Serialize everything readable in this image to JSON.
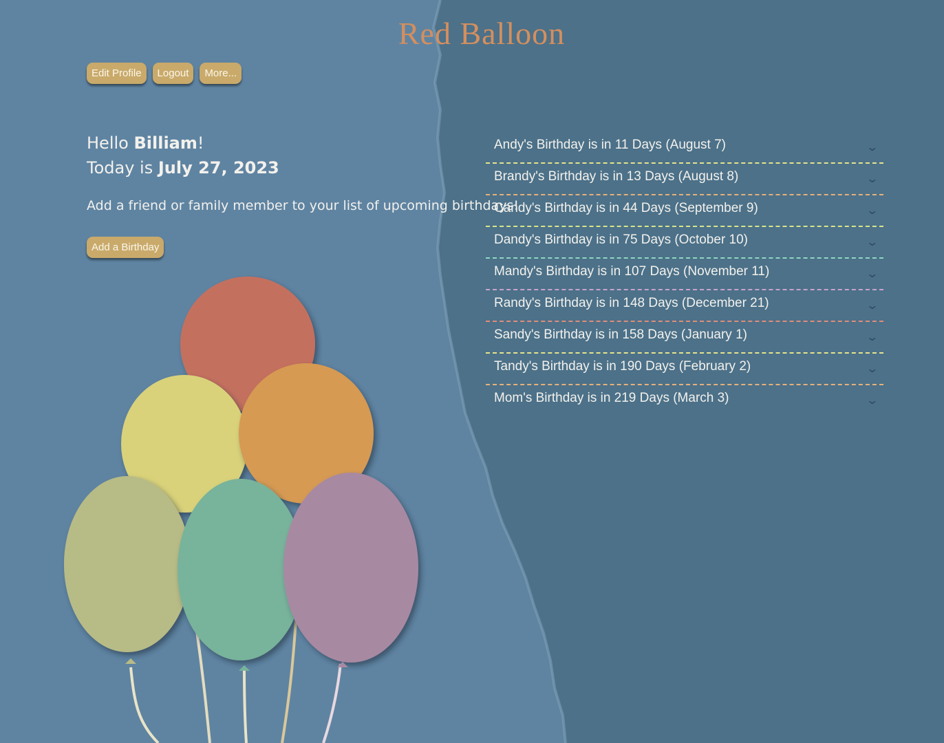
{
  "app": {
    "title": "Red Balloon"
  },
  "nav": {
    "edit_profile": "Edit Profile",
    "logout": "Logout",
    "more": "More..."
  },
  "greeting": {
    "hello": "Hello ",
    "name": "Billiam",
    "bang": "!",
    "today_prefix": "Today is ",
    "date": "July 27, 2023"
  },
  "prompt": "Add a friend or family member to your list of upcoming birthdays!",
  "add_button": "Add a Birthday",
  "birthdays": [
    {
      "label": "Andy's Birthday is in 11 Days (August 7)",
      "color": "#e6e48a"
    },
    {
      "label": "Brandy's Birthday is in 13 Days (August 8)",
      "color": "#e8b07a"
    },
    {
      "label": "Candy's Birthday is in 44 Days (September 9)",
      "color": "#d9e58a"
    },
    {
      "label": "Dandy's Birthday is in 75 Days (October 10)",
      "color": "#8fd8c2"
    },
    {
      "label": "Mandy's Birthday is in 107 Days (November 11)",
      "color": "#c9a3cc"
    },
    {
      "label": "Randy's Birthday is in 148 Days (December 21)",
      "color": "#e28c7a"
    },
    {
      "label": "Sandy's Birthday is in 158 Days (January 1)",
      "color": "#e6e48a"
    },
    {
      "label": "Tandy's Birthday is in 190 Days (February 2)",
      "color": "#e8b07a"
    },
    {
      "label": "Mom's Birthday is in 219 Days (March 3)",
      "color": "none"
    }
  ],
  "colors": {
    "left_bg": "#5f84a2",
    "right_bg": "#4c7189",
    "title": "#d58f5e",
    "button": "#c9aa6a",
    "balloon_red": "#c4705f",
    "balloon_yellow": "#d9d27a",
    "balloon_orange": "#d69a52",
    "balloon_olive": "#b7bb86",
    "balloon_green": "#78b39b",
    "balloon_purple": "#a889a2"
  },
  "icons": {
    "chevron": "chevron-down-icon"
  }
}
